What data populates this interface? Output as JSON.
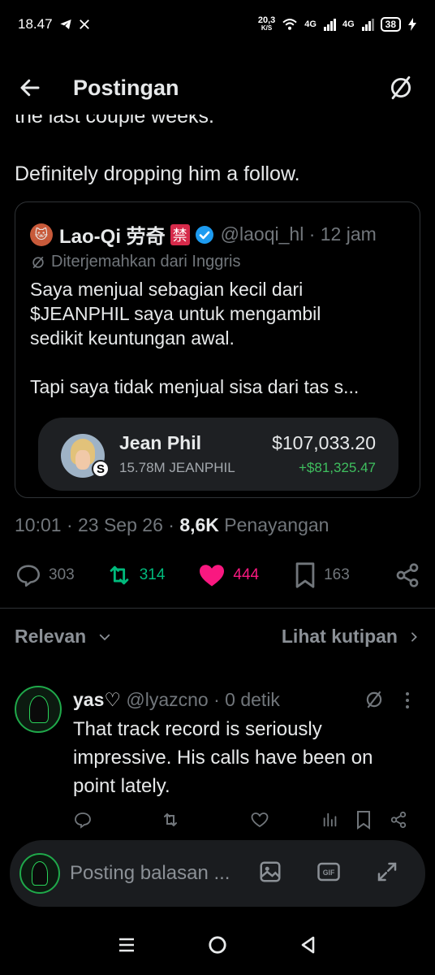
{
  "status_bar": {
    "time": "18.47",
    "speed_value": "20,3",
    "speed_unit": "K/S",
    "net1": "4G",
    "net2": "4G",
    "battery": "38"
  },
  "header": {
    "title": "Postingan"
  },
  "post": {
    "clipped_line": "the last couple weeks.",
    "text": "Definitely dropping him a follow.",
    "timestamp": "10:01 · 23 Sep 26 · ",
    "views_count": "8,6K",
    "views_label": " Penayangan"
  },
  "quote": {
    "name": "Lao-Qi 劳奇",
    "badge": "禁",
    "handle_time": "@laoqi_hl · 12 jam",
    "translated_label": "Diterjemahkan dari Inggris",
    "body_line1": "Saya menjual sebagian kecil dari",
    "body_line2": "$JEANPHIL saya untuk mengambil",
    "body_line3": "sedikit keuntungan awal.",
    "body_line4": "Tapi saya tidak menjual sisa dari tas s..."
  },
  "token_card": {
    "name": "Jean Phil",
    "holdings": "15.78M JEANPHIL",
    "price": "$107,033.20",
    "change": "+$81,325.47",
    "badge_letter": "S"
  },
  "actions": {
    "replies": "303",
    "reposts": "314",
    "likes": "444",
    "bookmarks": "163"
  },
  "filter": {
    "sort_label": "Relevan",
    "quotes_label": "Lihat kutipan"
  },
  "reply": {
    "name": "yas♡",
    "handle_time": " @lyazcno · 0 detik",
    "body": "That track record is seriously impressive. His calls have been on point lately."
  },
  "composer": {
    "placeholder": "Posting balasan ..."
  },
  "colors": {
    "accent_blue": "#1d9bf0",
    "retweet_green": "#00ba7c",
    "like_pink": "#f91880",
    "profit_green": "#3fbf5f"
  }
}
